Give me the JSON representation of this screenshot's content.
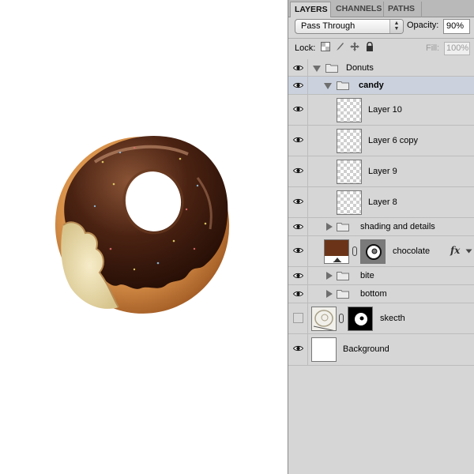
{
  "panel": {
    "tabs": [
      {
        "label": "LAYERS",
        "active": true
      },
      {
        "label": "CHANNELS",
        "active": false
      },
      {
        "label": "PATHS",
        "active": false
      }
    ],
    "blend_mode": "Pass Through",
    "opacity_label": "Opacity:",
    "opacity_value": "90%",
    "lock_label": "Lock:",
    "fill_label": "Fill:",
    "fill_value": "100%"
  },
  "layers": [
    {
      "name": "Donuts",
      "kind": "group",
      "expanded": true,
      "visible": true
    },
    {
      "name": "candy",
      "kind": "group",
      "expanded": true,
      "visible": true,
      "selected": true
    },
    {
      "name": "Layer 10",
      "kind": "layer",
      "visible": true
    },
    {
      "name": "Layer 6 copy",
      "kind": "layer",
      "visible": true
    },
    {
      "name": "Layer 9",
      "kind": "layer",
      "visible": true
    },
    {
      "name": "Layer 8",
      "kind": "layer",
      "visible": true
    },
    {
      "name": "shading and details",
      "kind": "group",
      "expanded": false,
      "visible": true
    },
    {
      "name": "chocolate",
      "kind": "fill-layer",
      "visible": true,
      "fill_color": "#6b3418",
      "has_effects": true
    },
    {
      "name": "bite",
      "kind": "group",
      "expanded": false,
      "visible": true
    },
    {
      "name": "bottom",
      "kind": "group",
      "expanded": false,
      "visible": true
    },
    {
      "name": "skecth",
      "kind": "masked-layer",
      "visible": false
    },
    {
      "name": "Background",
      "kind": "layer",
      "visible": true
    }
  ],
  "colors": {
    "panel_bg": "#d6d6d6",
    "selected_row": "#cbd2de",
    "chocolate": "#4a2212",
    "dough": "#d9924a"
  },
  "icons": {
    "visibility": "eye-icon",
    "lock_transparent": "lock-transparent-pixels-icon",
    "lock_image": "lock-image-pixels-icon",
    "lock_position": "lock-position-icon",
    "lock_all": "lock-all-icon",
    "group": "folder-icon",
    "link": "chain-link-icon",
    "effects": "fx-icon"
  }
}
